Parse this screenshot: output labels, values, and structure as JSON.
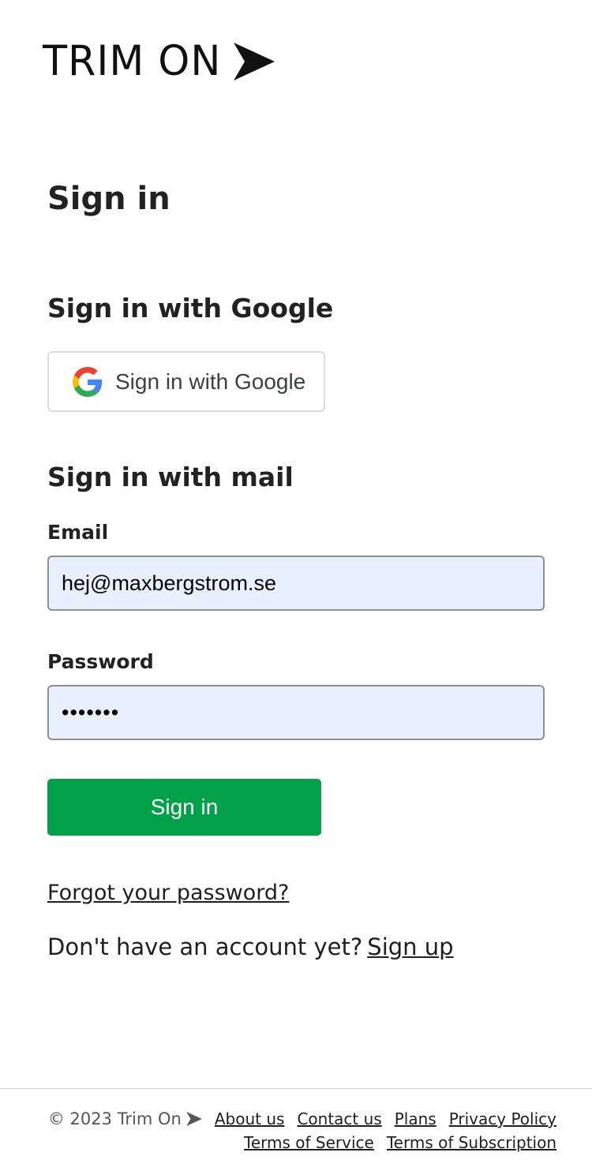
{
  "logo": {
    "text": "TRIM ON"
  },
  "page_title": "Sign in",
  "google_section": {
    "heading": "Sign in with Google",
    "button_label": "Sign in with Google"
  },
  "mail_section": {
    "heading": "Sign in with mail",
    "email_label": "Email",
    "email_value": "hej@maxbergstrom.se",
    "password_label": "Password",
    "password_value": "•••••••",
    "submit_label": "Sign in"
  },
  "forgot_password": "Forgot your password?",
  "signup": {
    "prompt": "Don't have an account yet?",
    "link": "Sign up"
  },
  "footer": {
    "copyright": "© 2023 Trim On",
    "links_row1": [
      "About us",
      "Contact us",
      "Plans",
      "Privacy Policy"
    ],
    "links_row2": [
      "Terms of Service",
      "Terms of Subscription"
    ]
  },
  "colors": {
    "primary_button": "#03a04a",
    "input_background": "#e8f0fe"
  }
}
